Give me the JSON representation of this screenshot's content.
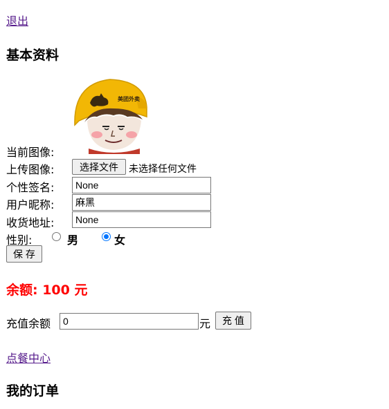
{
  "logout_link": "退出",
  "profile": {
    "heading": "基本资料",
    "current_avatar_label": "当前图像:",
    "upload_label": "上传图像:",
    "choose_file_button": "选择文件",
    "no_file_text": "未选择任何文件",
    "signature_label": "个性签名:",
    "signature_value": "None",
    "nickname_label": "用户昵称:",
    "nickname_value": "麻黑",
    "address_label": "收货地址:",
    "address_value": "None",
    "gender_label": "性别:",
    "gender_male": "男",
    "gender_female": "女",
    "gender_selected": "female",
    "save_button": "保 存"
  },
  "balance": {
    "heading": "余额: 100 元",
    "color": "#ff0000",
    "recharge_label": "充值余额",
    "recharge_value": "0",
    "unit": "元",
    "recharge_button": "充 值"
  },
  "order_center_link": "点餐中心",
  "orders_heading": "我的订单",
  "avatar_helmet_text": "美团外卖"
}
